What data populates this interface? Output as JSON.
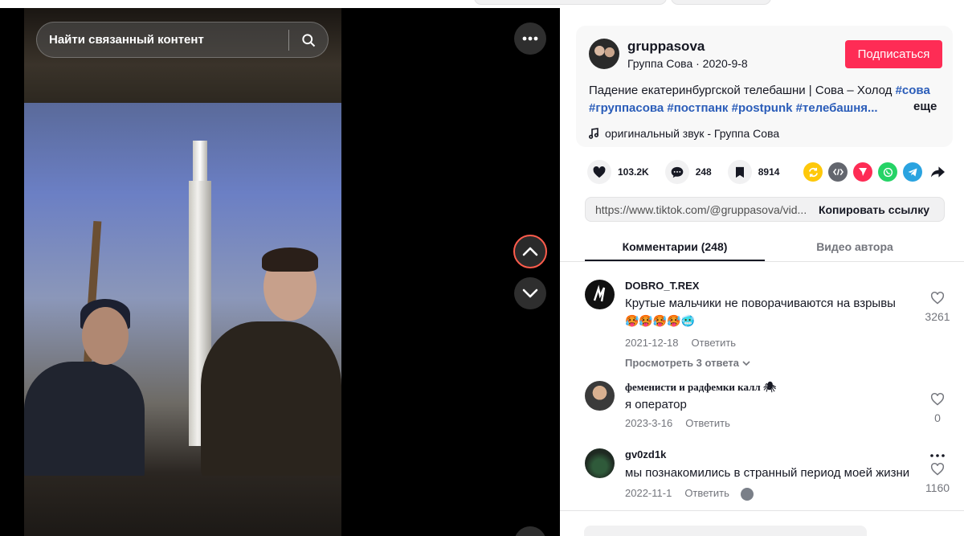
{
  "video": {
    "search_placeholder": "Найти связанный контент"
  },
  "author": {
    "username": "gruppasova",
    "subline": "Группа Сова · 2020-9-8",
    "follow_label": "Подписаться"
  },
  "description": {
    "text": "Падение екатеринбургской телебашни | Сова – Холод ",
    "tags": [
      "#сова",
      "#группасова",
      "#постпанк",
      "#postpunk",
      "#телебашня..."
    ],
    "more_label": "еще",
    "music": "оригинальный звук - Группа Сова"
  },
  "actions": {
    "likes": "103.2K",
    "comments": "248",
    "saves": "8914"
  },
  "share": {
    "colors": {
      "repost": "#fec80a",
      "embed": "#63666e",
      "send": "#fe2c55",
      "whatsapp": "#25d366",
      "telegram": "#2aa3e0"
    }
  },
  "link": {
    "url": "https://www.tiktok.com/@gruppasova/vid...",
    "copy_label": "Копировать ссылку"
  },
  "tabs": {
    "comments": "Комментарии (248)",
    "creator_videos": "Видео автора"
  },
  "comments": [
    {
      "user": "DOBRO_T.REX",
      "text": "Крутые мальчики не поворачиваются на взрывы",
      "emojis": "🥵🥵🥵🥵🥶",
      "date": "2021-12-18",
      "reply": "Ответить",
      "likes": "3261",
      "view_replies": "Просмотреть 3 ответа"
    },
    {
      "user": "феменисти и радфемки калл 🕷",
      "text": "я оператор",
      "date": "2023-3-16",
      "reply": "Ответить",
      "likes": "0"
    },
    {
      "user": "gv0zd1k",
      "text": "мы познакомились в странный период моей жизни",
      "date": "2022-11-1",
      "reply": "Ответить",
      "likes": "1160"
    }
  ],
  "accent": "#fe2c55"
}
